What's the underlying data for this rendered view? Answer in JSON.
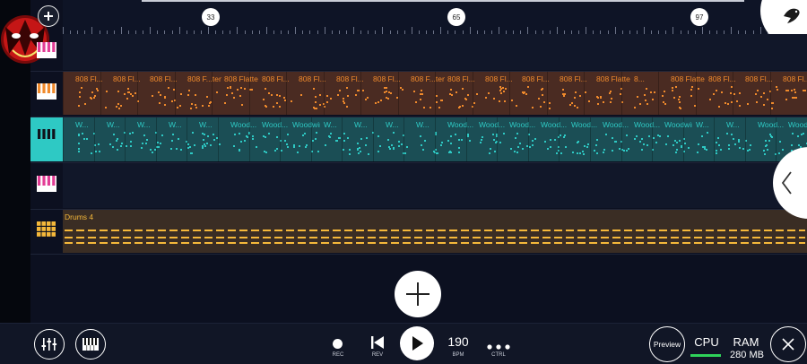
{
  "colors": {
    "background": "#0c1020",
    "orange": "#f08a2c",
    "teal": "#2ec9c4",
    "pink": "#e23d96",
    "yellow": "#f5b83a",
    "cpu_meter": "#2fd35a"
  },
  "timeline": {
    "markers": [
      "33",
      "65",
      "97"
    ]
  },
  "tracks": [
    {
      "icon": "piano-keys-icon",
      "color": "pink",
      "clips": []
    },
    {
      "icon": "piano-keys-icon",
      "color": "orange",
      "clips": [
        "808 Fl...",
        "808 Fl...",
        "808 Fl...",
        "808 F...tened 8...",
        "808 Flattened",
        "808 Fl...",
        "808 Fl...",
        "808 Fl...",
        "808 Fl...",
        "808 F...tened 8...",
        "808 Fl...",
        "808 Fl...",
        "808 Fl...",
        "808 Fl...",
        "808 Flatte...",
        "8...",
        "808 Flattened",
        "808 Fl...",
        "808 Fl...",
        "808 Fl..."
      ]
    },
    {
      "icon": "piano-keys-icon",
      "color": "teal",
      "clips": [
        "W...",
        "W...",
        "W...",
        "W...",
        "W...",
        "Wood...",
        "Wood...",
        "Woodwin...ction",
        "W...",
        "W...",
        "W...",
        "W...",
        "Wood...",
        "Wood...",
        "Wood...",
        "Wood...",
        "Wood...",
        "Wood...",
        "Wood...",
        "Woodwin...ction",
        "W...",
        "W...",
        "Wood...",
        "Wood..."
      ]
    },
    {
      "icon": "piano-keys-icon",
      "color": "pink",
      "clips": []
    },
    {
      "icon": "drum-pads-icon",
      "color": "yellow",
      "clips": [
        "Drums 4"
      ]
    }
  ],
  "transport": {
    "rec_label": "REC",
    "rev_label": "REV",
    "bpm_value": "190",
    "bpm_label": "BPM",
    "ctrl_label": "CTRL",
    "preview_label": "Preview",
    "cpu_label": "CPU",
    "ram_label": "RAM",
    "ram_value": "280 MB"
  }
}
